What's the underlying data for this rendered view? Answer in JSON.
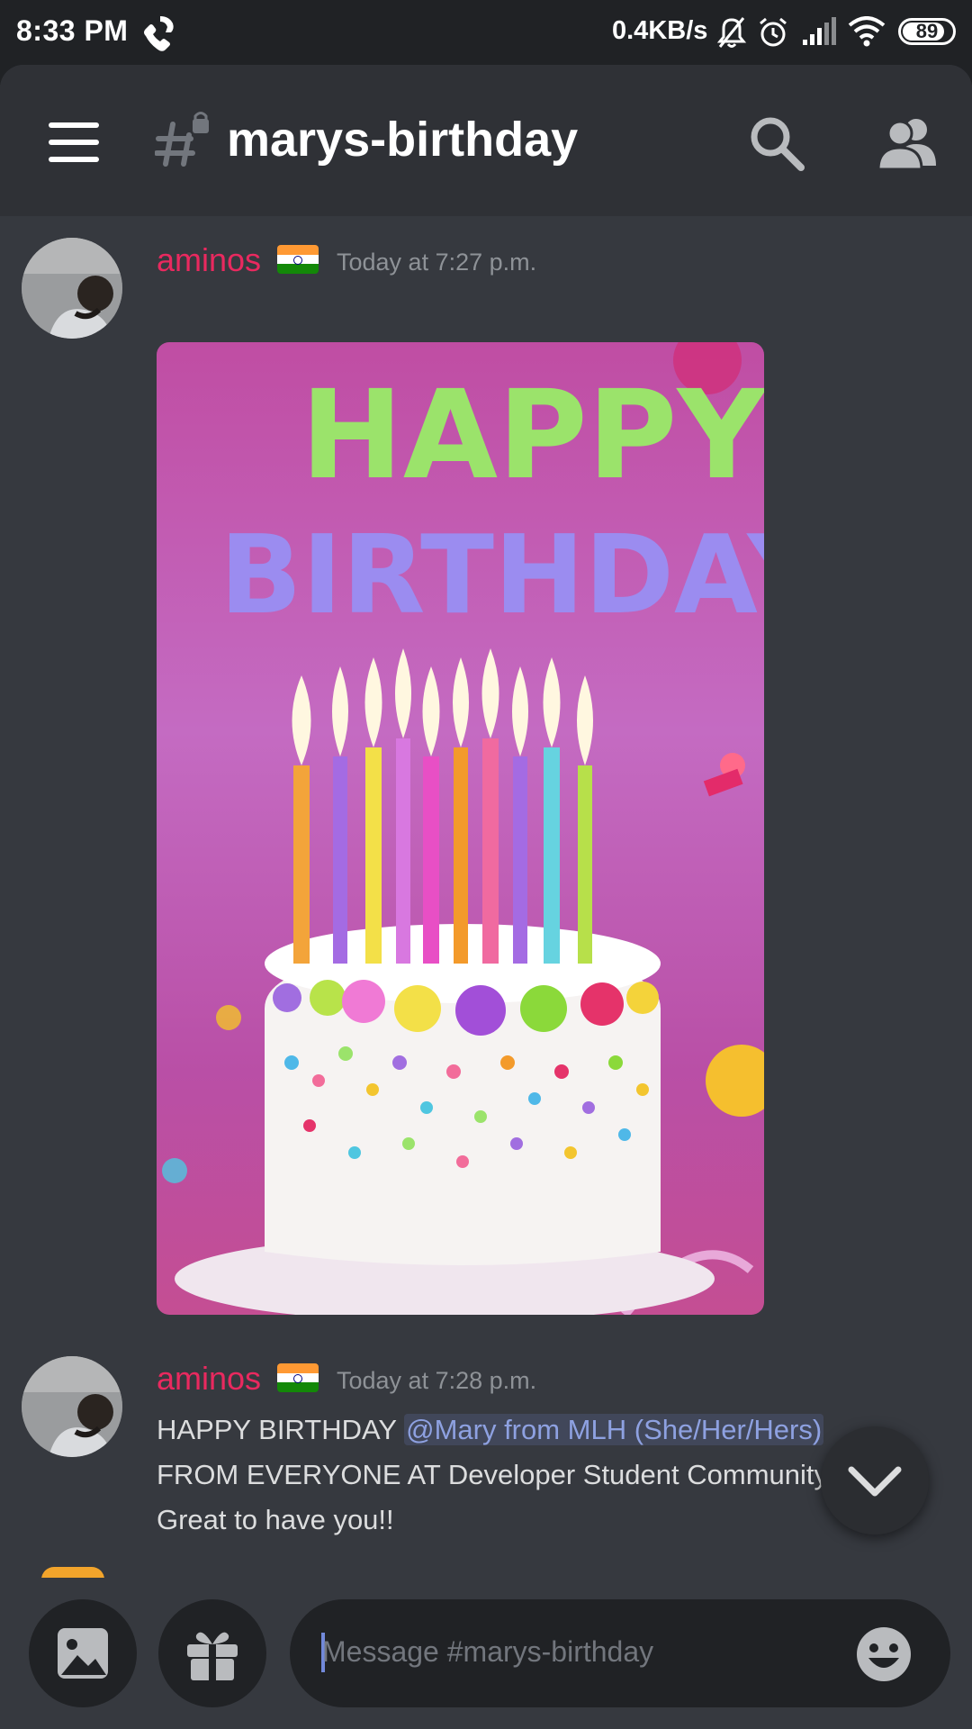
{
  "status_bar": {
    "time": "8:33 PM",
    "net_speed": "0.4KB/s",
    "battery": "89",
    "icons": [
      "call-icon",
      "mute-bell-icon",
      "alarm-icon",
      "signal-icon",
      "wifi-icon",
      "battery-icon"
    ]
  },
  "header": {
    "channel_name": "marys-birthday",
    "icons": [
      "menu-icon",
      "locked-channel-hash-icon",
      "search-icon",
      "members-icon"
    ]
  },
  "messages": [
    {
      "author": "aminos",
      "flag": "india-flag",
      "timestamp": "Today at 7:27 p.m.",
      "attachment": {
        "type": "gif",
        "text_line1": "HAPPY",
        "text_line2": "BIRTHDAY"
      }
    },
    {
      "author": "aminos",
      "flag": "india-flag",
      "timestamp": "Today at 7:28 p.m.",
      "line1_prefix": "HAPPY BIRTHDAY ",
      "mention": "@Mary from MLH (She/Her/Hers)",
      "line2": "FROM EVERYONE AT Developer Student Community",
      "line3": "Great to have you!!"
    }
  ],
  "composer": {
    "placeholder": "Message #marys-birthday",
    "icons": [
      "image-icon",
      "gift-icon",
      "emoji-icon"
    ]
  },
  "colors": {
    "background": "#36393f",
    "header": "#2f3136",
    "author": "#e9295f",
    "mention": "#8ea1e1",
    "accent": "#7289da"
  }
}
